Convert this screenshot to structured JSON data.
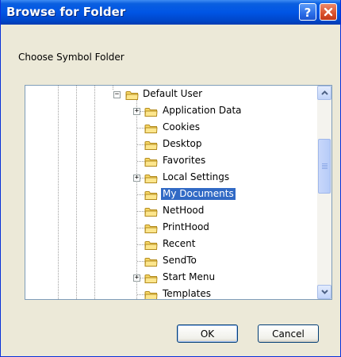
{
  "window": {
    "title": "Browse for Folder",
    "title_bar_color": "#0055e5",
    "close_button_color": "#d9512c"
  },
  "dialog": {
    "instruction": "Choose Symbol Folder"
  },
  "tree": {
    "selected_color": "#316ac5",
    "items": [
      {
        "label": "Default User",
        "expander": "minus",
        "selected": false
      },
      {
        "label": "Application Data",
        "expander": "plus",
        "selected": false
      },
      {
        "label": "Cookies",
        "expander": "none",
        "selected": false
      },
      {
        "label": "Desktop",
        "expander": "none",
        "selected": false
      },
      {
        "label": "Favorites",
        "expander": "none",
        "selected": false
      },
      {
        "label": "Local Settings",
        "expander": "plus",
        "selected": false
      },
      {
        "label": "My Documents",
        "expander": "none",
        "selected": true
      },
      {
        "label": "NetHood",
        "expander": "none",
        "selected": false
      },
      {
        "label": "PrintHood",
        "expander": "none",
        "selected": false
      },
      {
        "label": "Recent",
        "expander": "none",
        "selected": false
      },
      {
        "label": "SendTo",
        "expander": "none",
        "selected": false
      },
      {
        "label": "Start Menu",
        "expander": "plus",
        "selected": false
      },
      {
        "label": "Templates",
        "expander": "none",
        "selected": false
      }
    ]
  },
  "buttons": {
    "ok": "OK",
    "cancel": "Cancel"
  },
  "icons": {
    "help": "help-icon",
    "close": "close-icon",
    "folder": "folder-icon",
    "scroll_up": "chevron-up-icon",
    "scroll_down": "chevron-down-icon"
  }
}
